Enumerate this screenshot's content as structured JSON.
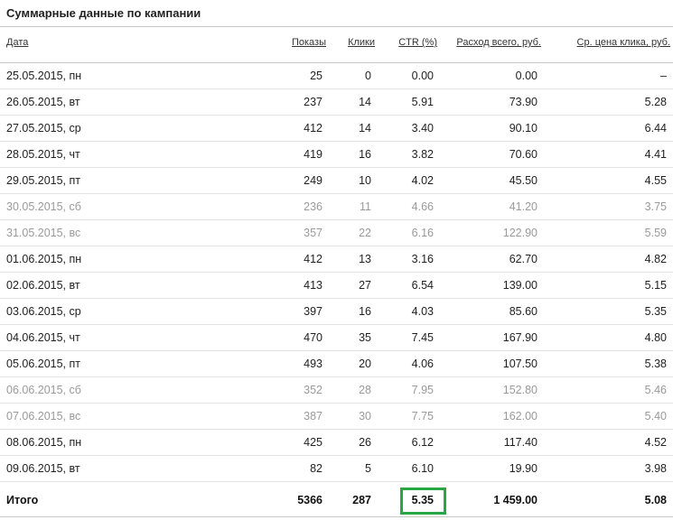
{
  "title": "Суммарные данные по кампании",
  "columns": {
    "date": "Дата",
    "shows": "Показы",
    "clicks": "Клики",
    "ctr": "CTR (%)",
    "cost": "Расход всего, руб.",
    "cpc": "Ср. цена клика, руб."
  },
  "rows": [
    {
      "date": "25.05.2015, пн",
      "shows": "25",
      "clicks": "0",
      "ctr": "0.00",
      "cost": "0.00",
      "cpc": "–",
      "weekend": false
    },
    {
      "date": "26.05.2015, вт",
      "shows": "237",
      "clicks": "14",
      "ctr": "5.91",
      "cost": "73.90",
      "cpc": "5.28",
      "weekend": false
    },
    {
      "date": "27.05.2015, ср",
      "shows": "412",
      "clicks": "14",
      "ctr": "3.40",
      "cost": "90.10",
      "cpc": "6.44",
      "weekend": false
    },
    {
      "date": "28.05.2015, чт",
      "shows": "419",
      "clicks": "16",
      "ctr": "3.82",
      "cost": "70.60",
      "cpc": "4.41",
      "weekend": false
    },
    {
      "date": "29.05.2015, пт",
      "shows": "249",
      "clicks": "10",
      "ctr": "4.02",
      "cost": "45.50",
      "cpc": "4.55",
      "weekend": false
    },
    {
      "date": "30.05.2015, сб",
      "shows": "236",
      "clicks": "11",
      "ctr": "4.66",
      "cost": "41.20",
      "cpc": "3.75",
      "weekend": true
    },
    {
      "date": "31.05.2015, вс",
      "shows": "357",
      "clicks": "22",
      "ctr": "6.16",
      "cost": "122.90",
      "cpc": "5.59",
      "weekend": true
    },
    {
      "date": "01.06.2015, пн",
      "shows": "412",
      "clicks": "13",
      "ctr": "3.16",
      "cost": "62.70",
      "cpc": "4.82",
      "weekend": false
    },
    {
      "date": "02.06.2015, вт",
      "shows": "413",
      "clicks": "27",
      "ctr": "6.54",
      "cost": "139.00",
      "cpc": "5.15",
      "weekend": false
    },
    {
      "date": "03.06.2015, ср",
      "shows": "397",
      "clicks": "16",
      "ctr": "4.03",
      "cost": "85.60",
      "cpc": "5.35",
      "weekend": false
    },
    {
      "date": "04.06.2015, чт",
      "shows": "470",
      "clicks": "35",
      "ctr": "7.45",
      "cost": "167.90",
      "cpc": "4.80",
      "weekend": false
    },
    {
      "date": "05.06.2015, пт",
      "shows": "493",
      "clicks": "20",
      "ctr": "4.06",
      "cost": "107.50",
      "cpc": "5.38",
      "weekend": false
    },
    {
      "date": "06.06.2015, сб",
      "shows": "352",
      "clicks": "28",
      "ctr": "7.95",
      "cost": "152.80",
      "cpc": "5.46",
      "weekend": true
    },
    {
      "date": "07.06.2015, вс",
      "shows": "387",
      "clicks": "30",
      "ctr": "7.75",
      "cost": "162.00",
      "cpc": "5.40",
      "weekend": true
    },
    {
      "date": "08.06.2015, пн",
      "shows": "425",
      "clicks": "26",
      "ctr": "6.12",
      "cost": "117.40",
      "cpc": "4.52",
      "weekend": false
    },
    {
      "date": "09.06.2015, вт",
      "shows": "82",
      "clicks": "5",
      "ctr": "6.10",
      "cost": "19.90",
      "cpc": "3.98",
      "weekend": false
    }
  ],
  "total": {
    "label": "Итого",
    "shows": "5366",
    "clicks": "287",
    "ctr": "5.35",
    "cost": "1 459.00",
    "cpc": "5.08"
  },
  "colors": {
    "highlight_border": "#27a844",
    "weekend_text": "#9a9a9a"
  }
}
